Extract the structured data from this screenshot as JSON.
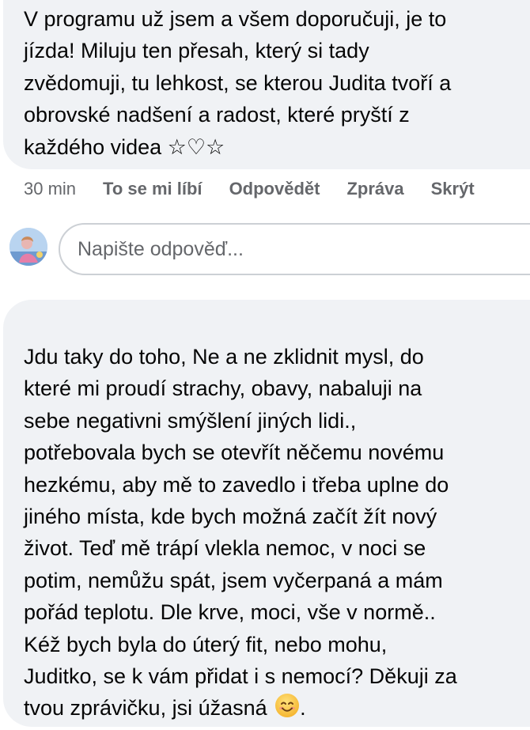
{
  "comments": [
    {
      "text": "V programu už jsem a všem doporučuji, je to\njízda! Miluju ten přesah, který si tady\nzvědomuji, tu lehkost, se kterou Judita tvoří a\nobrovské nadšení a radost, které pryští z\nkaždého videa ☆♡☆",
      "time": "30 min",
      "actions": [
        "To se mi líbí",
        "Odpovědět",
        "Zpráva",
        "Skrýt"
      ]
    },
    {
      "text": "Jdu taky do toho, Ne a ne zklidnit mysl, do\nkteré mi proudí strachy, obavy, nabaluji na\nsebe negativni smýšlení jiných lidi.,\npotřebovala bych se otevřít něčemu novému\nhezkému, aby mě to zavedlo i třeba uplne do\njiného místa, kde bych možná začít žít nový\nživot. Teď mě trápí vlekla nemoc, v noci se\npotim, nemůžu spát, jsem vyčerpaná a mám\npořád teplotu. Dle krve, moci, vše v normě..\nKéž bych byla do úterý fit, nebo mohu,\nJuditko, se k vám přidat i s nemocí? Děkuji za\ntvou zprávičku, jsi úžasná",
      "emoji": "smiling-face-emoji"
    }
  ],
  "reply": {
    "placeholder": "Napište odpověď..."
  },
  "colors": {
    "bubble": "#f0f2f5",
    "secondary_text": "#65676b",
    "input_border": "#ccd0d5"
  }
}
